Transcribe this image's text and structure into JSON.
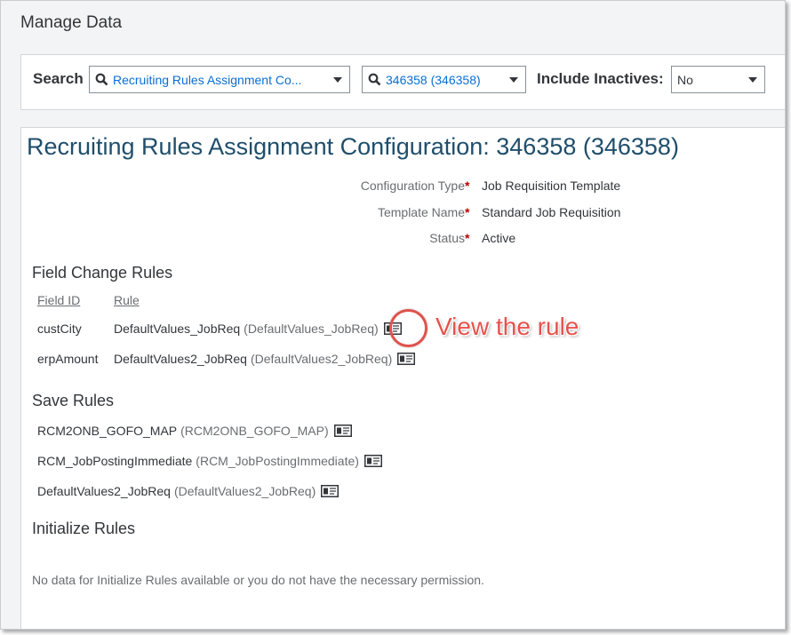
{
  "app": {
    "title": "Manage Data"
  },
  "search": {
    "label": "Search",
    "object_value": "Recruiting Rules Assignment Co...",
    "record_value": "346358 (346358)",
    "include_inactives_label": "Include Inactives:",
    "include_inactives_value": "No"
  },
  "page": {
    "title": "Recruiting Rules Assignment Configuration: 346358 (346358)"
  },
  "form": {
    "config_type_label": "Configuration Type",
    "config_type_value": "Job Requisition Template",
    "template_name_label": "Template Name",
    "template_name_value": "Standard Job Requisition",
    "status_label": "Status",
    "status_value": "Active",
    "required_mark": "*"
  },
  "field_change_rules": {
    "title": "Field Change Rules",
    "col_field_id": "Field ID",
    "col_rule": "Rule",
    "rows": [
      {
        "field_id": "custCity",
        "rule": "DefaultValues_JobReq",
        "rule_id": "(DefaultValues_JobReq)"
      },
      {
        "field_id": "erpAmount",
        "rule": "DefaultValues2_JobReq",
        "rule_id": "(DefaultValues2_JobReq)"
      }
    ]
  },
  "save_rules": {
    "title": "Save Rules",
    "rows": [
      {
        "rule": "RCM2ONB_GOFO_MAP",
        "rule_id": "(RCM2ONB_GOFO_MAP)"
      },
      {
        "rule": "RCM_JobPostingImmediate",
        "rule_id": "(RCM_JobPostingImmediate)"
      },
      {
        "rule": "DefaultValues2_JobReq",
        "rule_id": "(DefaultValues2_JobReq)"
      }
    ]
  },
  "initialize_rules": {
    "title": "Initialize Rules",
    "empty_message": "No data for Initialize Rules available or you do not have the necessary permission."
  },
  "annotation": {
    "text": "View the rule"
  },
  "icons": {
    "search": "magnifier-icon",
    "dropdown": "triangle-down-icon",
    "rule_detail": "business-card-icon"
  },
  "colors": {
    "link": "#0a6ed1",
    "title": "#1f4e6b",
    "required": "#bb0000",
    "annotation": "#e8514c"
  }
}
